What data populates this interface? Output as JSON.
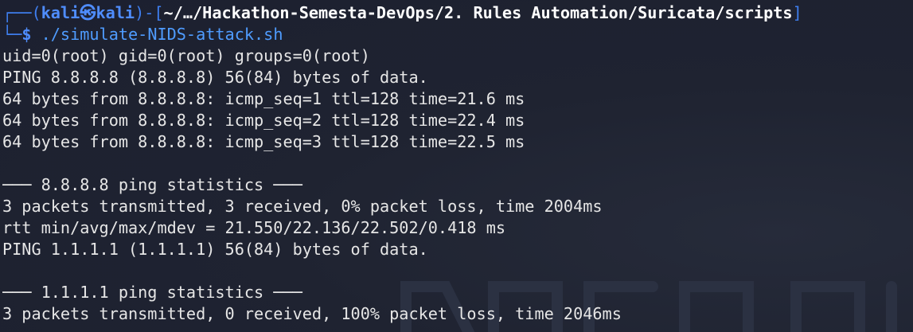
{
  "prompt": {
    "corner_top": "┌──(",
    "user": "kali",
    "at_symbol": "㉿",
    "host": "kali",
    "bracket_mid": ")-[",
    "path": "~/…/Hackathon-Semesta-DevOps/2. Rules Automation/Suricata/scripts",
    "bracket_end": "]",
    "corner_bottom": "└─",
    "dollar": "$",
    "command": " ./simulate-NIDS-attack.sh"
  },
  "output": [
    "uid=0(root) gid=0(root) groups=0(root)",
    "PING 8.8.8.8 (8.8.8.8) 56(84) bytes of data.",
    "64 bytes from 8.8.8.8: icmp_seq=1 ttl=128 time=21.6 ms",
    "64 bytes from 8.8.8.8: icmp_seq=2 ttl=128 time=22.4 ms",
    "64 bytes from 8.8.8.8: icmp_seq=3 ttl=128 time=22.5 ms",
    "",
    "─── 8.8.8.8 ping statistics ───",
    "3 packets transmitted, 3 received, 0% packet loss, time 2004ms",
    "rtt min/avg/max/mdev = 21.550/22.136/22.502/0.418 ms",
    "PING 1.1.1.1 (1.1.1.1) 56(84) bytes of data.",
    "",
    "─── 1.1.1.1 ping statistics ───",
    "3 packets transmitted, 0 received, 100% packet loss, time 2046ms"
  ],
  "colors": {
    "background": "#1e2230",
    "prompt_blue": "#4f8dff",
    "text": "#e6e6e6"
  }
}
